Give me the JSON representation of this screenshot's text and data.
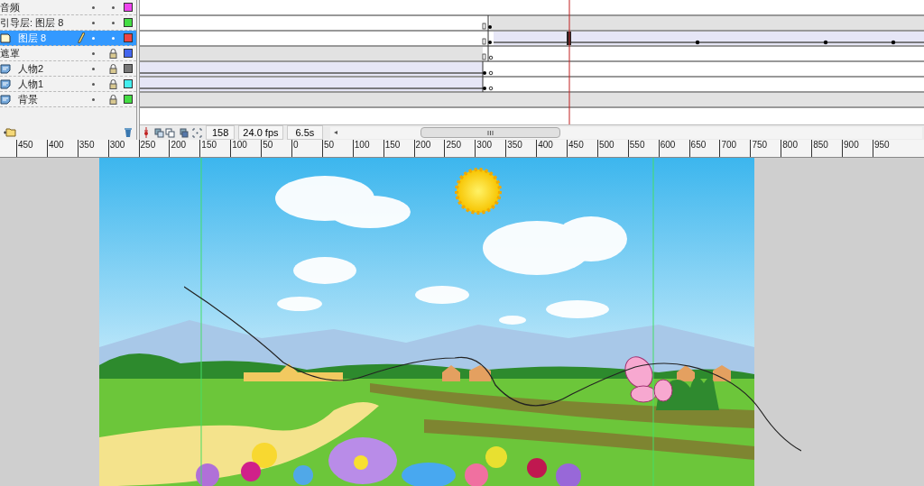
{
  "layers": [
    {
      "name": "音频",
      "selected": false,
      "locked": false,
      "color": "#ee44ee"
    },
    {
      "name": "引导层: 图层 8",
      "selected": false,
      "locked": false,
      "color": "#44dd44",
      "children": [
        {
          "name": "图层 8",
          "kind": "normal",
          "selected": true,
          "locked": false,
          "color": "#ee4444"
        }
      ]
    },
    {
      "name": "遮罩",
      "selected": false,
      "locked": true,
      "color": "#4466ee",
      "children": [
        {
          "name": "人物2",
          "kind": "masked",
          "selected": false,
          "locked": true,
          "color": "#777777"
        },
        {
          "name": "人物1",
          "kind": "masked",
          "selected": false,
          "locked": true,
          "color": "#44eeee"
        },
        {
          "name": "背景",
          "kind": "masked",
          "selected": false,
          "locked": true,
          "color": "#44dd44"
        }
      ]
    }
  ],
  "timeline_status": {
    "frame": "158",
    "fps": "24.0 fps",
    "time": "6.5s",
    "scroll_left": "◂"
  },
  "ruler": [
    "450",
    "400",
    "350",
    "300",
    "250",
    "200",
    "150",
    "100",
    "50",
    "0",
    "50",
    "100",
    "150",
    "200",
    "250",
    "300",
    "350",
    "400",
    "450",
    "500",
    "550",
    "600",
    "650",
    "700",
    "750",
    "800",
    "850",
    "900",
    "950"
  ]
}
